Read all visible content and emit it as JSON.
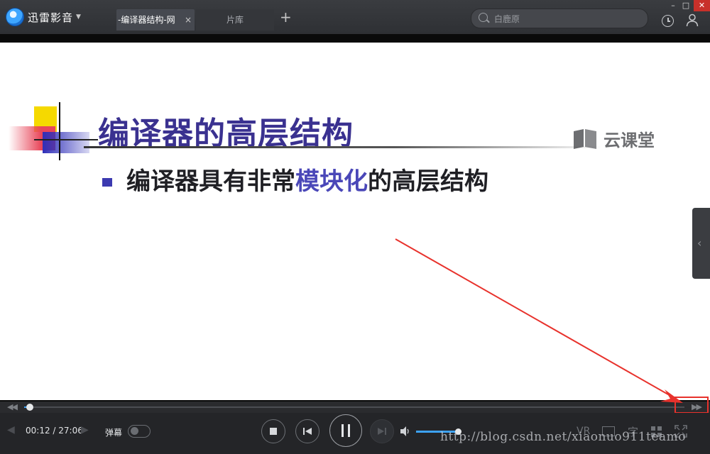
{
  "app": {
    "name": "迅雷影音",
    "window_controls": {
      "minimize": "–",
      "maximize": "□",
      "close": "✕"
    }
  },
  "tabs": [
    {
      "label": "-编译器结构-网",
      "close": "×",
      "active": true
    },
    {
      "label": "片库",
      "active": false
    }
  ],
  "tab_add": "+",
  "search": {
    "placeholder": "白鹿原",
    "icon": "search-icon"
  },
  "header_icons": [
    "history-icon",
    "user-icon"
  ],
  "slide": {
    "brand": "云课堂",
    "title": "编译器的高层结构",
    "bullet": {
      "before": "编译器具有非常",
      "highlight": "模块化",
      "after": "的高层结构"
    },
    "title_color": "#3a3190",
    "highlight_color": "#4a47b8"
  },
  "side_panel_toggle": "‹",
  "playback": {
    "current_time": "00:12",
    "total_time": "27:06",
    "time_display": "00:12 / 27:06",
    "progress": 0.009,
    "volume": 0.95,
    "danmu_label": "弹幕",
    "danmu_enabled": false
  },
  "toolbar_right": {
    "vr": "VR",
    "subtitle": "字"
  },
  "accent_color": "#3da2f5",
  "annotation_color": "#e8322c",
  "watermark": "http://blog.csdn.net/xiaonuo911teamo"
}
